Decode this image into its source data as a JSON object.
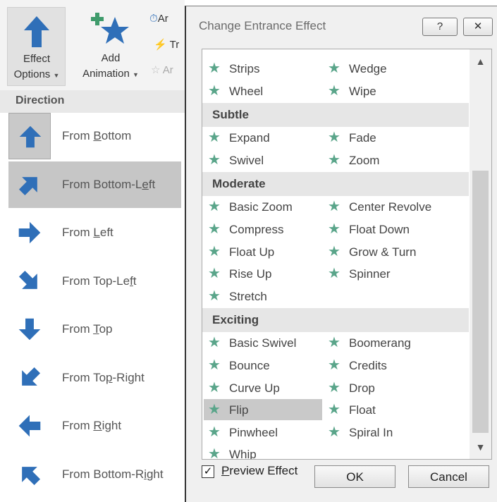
{
  "ribbon": {
    "effect_options": {
      "line1": "Effect",
      "line2": "Options"
    },
    "add_animation": {
      "line1": "Add",
      "line2": "Animation"
    },
    "small_items": [
      "Ar",
      "Tr",
      "Ar"
    ]
  },
  "direction_menu": {
    "header": "Direction",
    "items": [
      {
        "pre": "From ",
        "u": "B",
        "post": "ottom",
        "icon": "arrow-up-icon"
      },
      {
        "pre": "From Bottom-L",
        "u": "e",
        "post": "ft",
        "icon": "arrow-up-right-icon"
      },
      {
        "pre": "From ",
        "u": "L",
        "post": "eft",
        "icon": "arrow-right-icon"
      },
      {
        "pre": "From Top-Le",
        "u": "f",
        "post": "t",
        "icon": "arrow-down-right-icon"
      },
      {
        "pre": "From ",
        "u": "T",
        "post": "op",
        "icon": "arrow-down-icon"
      },
      {
        "pre": "From To",
        "u": "p",
        "post": "-Right",
        "icon": "arrow-down-left-icon"
      },
      {
        "pre": "From ",
        "u": "R",
        "post": "ight",
        "icon": "arrow-left-icon"
      },
      {
        "pre": "From Bottom-R",
        "u": "i",
        "post": "ght",
        "icon": "arrow-up-left-icon"
      }
    ],
    "selected_index": 1
  },
  "dialog": {
    "title": "Change Entrance Effect",
    "help_label": "?",
    "close_label": "✕",
    "top_rows": [
      [
        "Strips",
        "Wedge"
      ],
      [
        "Wheel",
        "Wipe"
      ]
    ],
    "groups": [
      {
        "name": "Subtle",
        "rows": [
          [
            "Expand",
            "Fade"
          ],
          [
            "Swivel",
            "Zoom"
          ]
        ]
      },
      {
        "name": "Moderate",
        "rows": [
          [
            "Basic Zoom",
            "Center Revolve"
          ],
          [
            "Compress",
            "Float Down"
          ],
          [
            "Float Up",
            "Grow & Turn"
          ],
          [
            "Rise Up",
            "Spinner"
          ],
          [
            "Stretch",
            ""
          ]
        ]
      },
      {
        "name": "Exciting",
        "rows": [
          [
            "Basic Swivel",
            "Boomerang"
          ],
          [
            "Bounce",
            "Credits"
          ],
          [
            "Curve Up",
            "Drop"
          ],
          [
            "Flip",
            "Float"
          ],
          [
            "Pinwheel",
            "Spiral In"
          ],
          [
            "Whip",
            ""
          ]
        ]
      }
    ],
    "selected_effect": "Flip",
    "preview": {
      "checked": true,
      "mark": "✓",
      "u": "P",
      "post": "review Effect"
    },
    "ok_label": "OK",
    "cancel_label": "Cancel"
  },
  "colors": {
    "star": "#5aa58a",
    "arrow": "#2f6fb8",
    "selection": "#c6c6c6"
  }
}
